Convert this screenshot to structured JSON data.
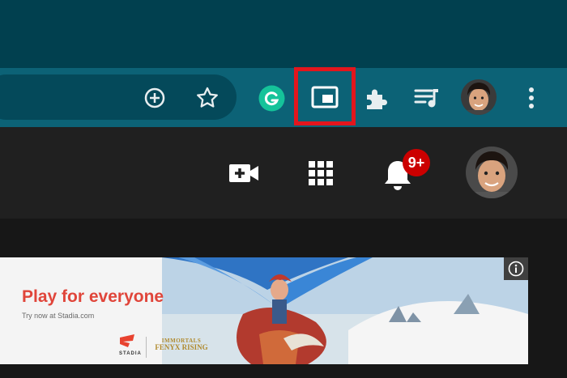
{
  "browser": {
    "toolbar_icons": [
      "add-circle-icon",
      "star-icon",
      "grammarly-icon",
      "picture-in-picture-icon",
      "extensions-icon",
      "media-queue-icon",
      "avatar",
      "more-vert-icon"
    ]
  },
  "youtube": {
    "header_icons": [
      "create-video-icon",
      "apps-grid-icon",
      "notifications-bell-icon",
      "avatar"
    ],
    "notification_badge": "9+"
  },
  "ad": {
    "headline": "Play for everyone",
    "subtext": "Try now at Stadia.com",
    "brand": "STADIA",
    "game_logo_line1": "IMMORTALS",
    "game_logo_line2": "FENYX RISING",
    "info_icon": "info-icon"
  },
  "colors": {
    "titlebar": "#01404f",
    "toolbar": "#0c6276",
    "omnibox": "#04495a",
    "highlight": "#e3161d",
    "youtube_header": "#202020",
    "badge": "#cc0000",
    "grammarly": "#15c39a",
    "ad_headline": "#e0453a"
  }
}
